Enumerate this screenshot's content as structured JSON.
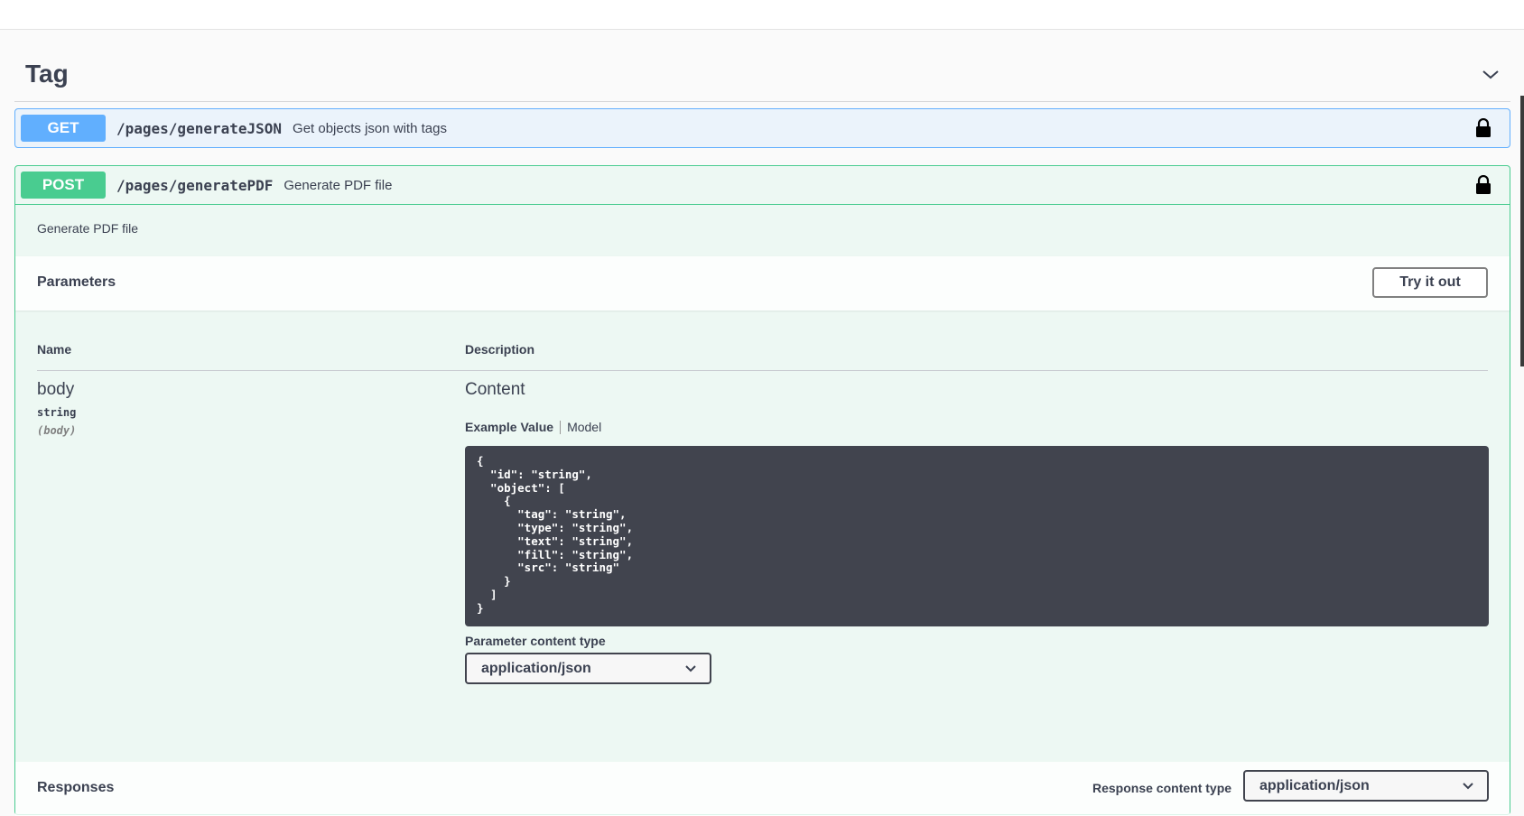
{
  "tag": {
    "title": "Tag"
  },
  "get_op": {
    "method": "GET",
    "path": "/pages/generateJSON",
    "summary": "Get objects json with tags"
  },
  "post_op": {
    "method": "POST",
    "path": "/pages/generatePDF",
    "summary": "Generate PDF file",
    "description": "Generate PDF file",
    "parameters_title": "Parameters",
    "try_button": "Try it out",
    "columns": {
      "name": "Name",
      "description": "Description"
    },
    "param": {
      "name": "body",
      "type": "string",
      "in": "(body)",
      "description": "Content"
    },
    "tabs": {
      "example": "Example Value",
      "model": "Model"
    },
    "example_value": "{\n  \"id\": \"string\",\n  \"object\": [\n    {\n      \"tag\": \"string\",\n      \"type\": \"string\",\n      \"text\": \"string\",\n      \"fill\": \"string\",\n      \"src\": \"string\"\n    }\n  ]\n}",
    "content_type_label": "Parameter content type",
    "content_type_value": "application/json",
    "responses_title": "Responses",
    "response_content_type_label": "Response content type",
    "response_content_type_value": "application/json"
  },
  "colors": {
    "get": "#61affe",
    "post": "#49cc90",
    "code_bg": "#41444e"
  }
}
